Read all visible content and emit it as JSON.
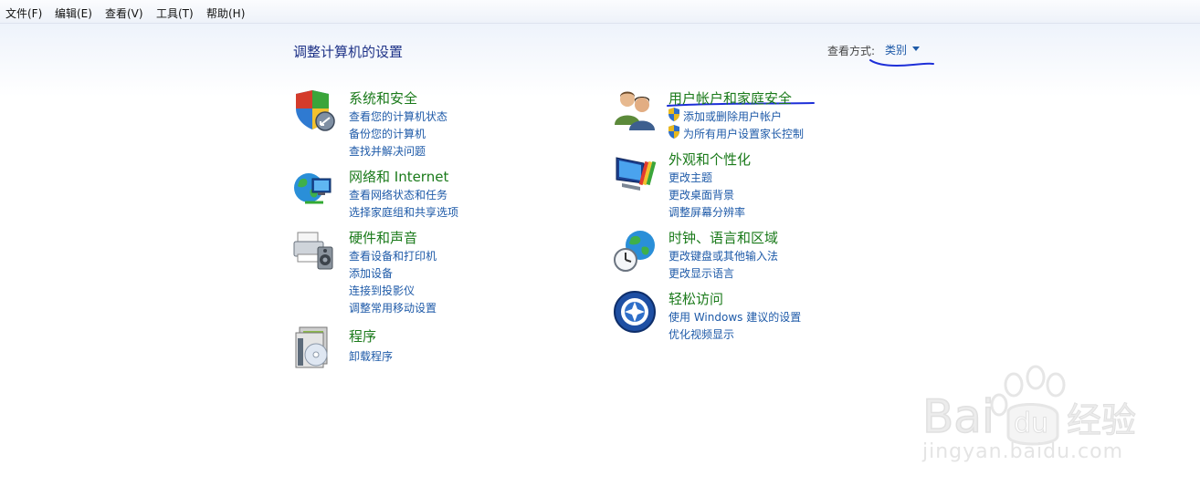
{
  "menu": [
    "文件(F)",
    "编辑(E)",
    "查看(V)",
    "工具(T)",
    "帮助(H)"
  ],
  "page_title": "调整计算机的设置",
  "view_by": {
    "label": "查看方式:",
    "value": "类别"
  },
  "categories": [
    {
      "title": "系统和安全",
      "icon": "shield-security-icon",
      "links": [
        "查看您的计算机状态",
        "备份您的计算机",
        "查找并解决问题"
      ]
    },
    {
      "title": "网络和 Internet",
      "icon": "network-globe-icon",
      "links": [
        "查看网络状态和任务",
        "选择家庭组和共享选项"
      ]
    },
    {
      "title": "硬件和声音",
      "icon": "printer-speaker-icon",
      "links": [
        "查看设备和打印机",
        "添加设备",
        "连接到投影仪",
        "调整常用移动设置"
      ]
    },
    {
      "title": "程序",
      "icon": "programs-disc-icon",
      "links": [
        "卸载程序"
      ]
    },
    {
      "title": "用户帐户和家庭安全",
      "icon": "users-icon",
      "links": [
        "添加或删除用户帐户",
        "为所有用户设置家长控制"
      ]
    },
    {
      "title": "外观和个性化",
      "icon": "monitor-palette-icon",
      "links": [
        "更改主题",
        "更改桌面背景",
        "调整屏幕分辨率"
      ]
    },
    {
      "title": "时钟、语言和区域",
      "icon": "clock-globe-icon",
      "links": [
        "更改键盘或其他输入法",
        "更改显示语言"
      ]
    },
    {
      "title": "轻松访问",
      "icon": "ease-of-access-icon",
      "links": [
        "使用 Windows 建议的设置",
        "优化视频显示"
      ]
    }
  ],
  "watermark": {
    "brand": "Bai du 经验",
    "url": "jingyan.baidu.com"
  }
}
